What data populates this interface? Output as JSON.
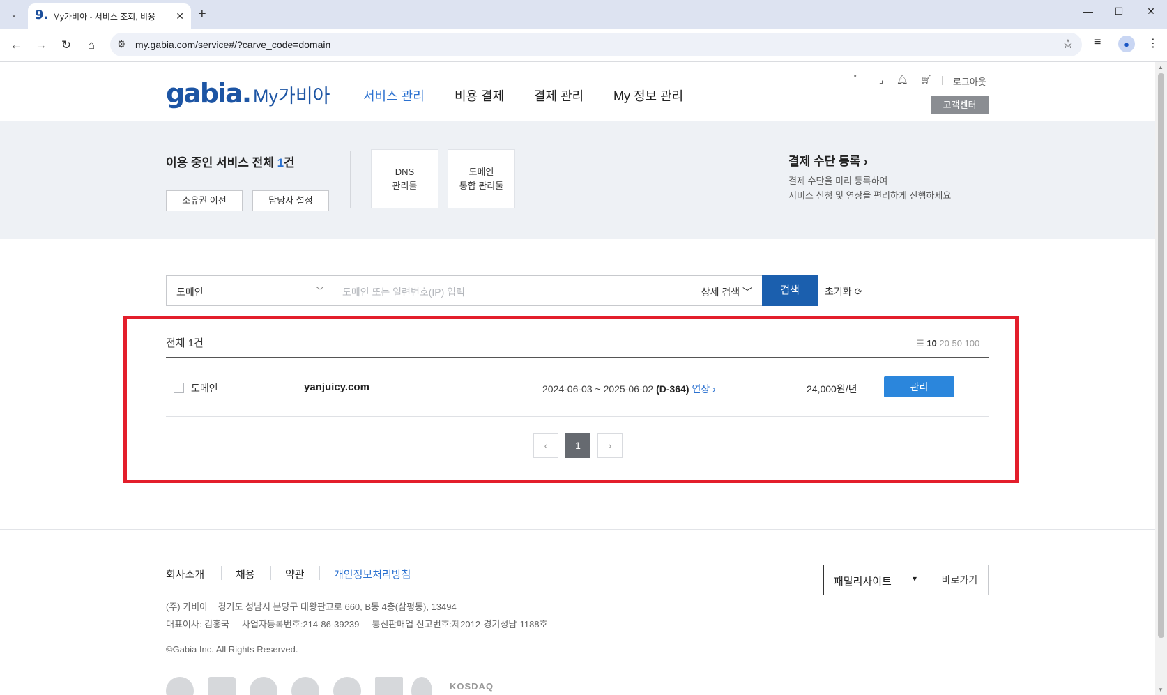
{
  "browser": {
    "tab_title": "My가비아 - 서비스 조회, 비용",
    "favicon": "9.",
    "url": "my.gabia.com/service#/?carve_code=domain"
  },
  "header": {
    "logo": "gabia.",
    "logo_sub": "My가비아",
    "nav": [
      "서비스 관리",
      "비용 결제",
      "결제 관리",
      "My 정보 관리"
    ],
    "logout": "로그아웃",
    "customer_center": "고객센터"
  },
  "summary": {
    "title_prefix": "이용 중인 서비스 전체 ",
    "title_count": "1",
    "title_suffix": "건",
    "btn_transfer": "소유권 이전",
    "btn_manager": "담당자 설정",
    "tool1_line1": "DNS",
    "tool1_line2": "관리툴",
    "tool2_line1": "도메인",
    "tool2_line2": "통합 관리툴",
    "pay_title": "결제 수단 등록",
    "pay_desc1": "결제 수단을 미리 등록하여",
    "pay_desc2": "서비스 신청 및 연장을 편리하게 진행하세요"
  },
  "search": {
    "category": "도메인",
    "placeholder": "도메인 또는 일련번호(IP) 입력",
    "advanced": "상세 검색",
    "button": "검색",
    "reset": "초기화"
  },
  "list": {
    "total": "전체 1건",
    "page_sizes": [
      "10",
      "20",
      "50",
      "100"
    ],
    "rows": [
      {
        "type": "도메인",
        "domain": "yanjuicy.com",
        "period": "2024-06-03 ~ 2025-06-02",
        "dday": "(D-364)",
        "renew": "연장",
        "price": "24,000원/년",
        "action": "관리"
      }
    ],
    "current_page": "1"
  },
  "footer": {
    "links": [
      "회사소개",
      "채용",
      "약관",
      "개인정보처리방침"
    ],
    "company": "(주) 가비아",
    "address": "경기도 성남시 분당구 대왕판교로 660, B동 4층(삼평동), 13494",
    "ceo": "대표이사: 김홍국",
    "biz_no": "사업자등록번호:214-86-39239",
    "ecommerce_no": "통신판매업 신고번호:제2012-경기성남-1188호",
    "copyright": "©Gabia Inc. All Rights Reserved.",
    "family_site": "패밀리사이트",
    "goto": "바로가기",
    "kosdaq": "KOSDAQ"
  },
  "colors": {
    "brand": "#1d55a4",
    "accent": "#2b71d0",
    "highlight_border": "#e31e2b",
    "search_button": "#1b5fae"
  }
}
